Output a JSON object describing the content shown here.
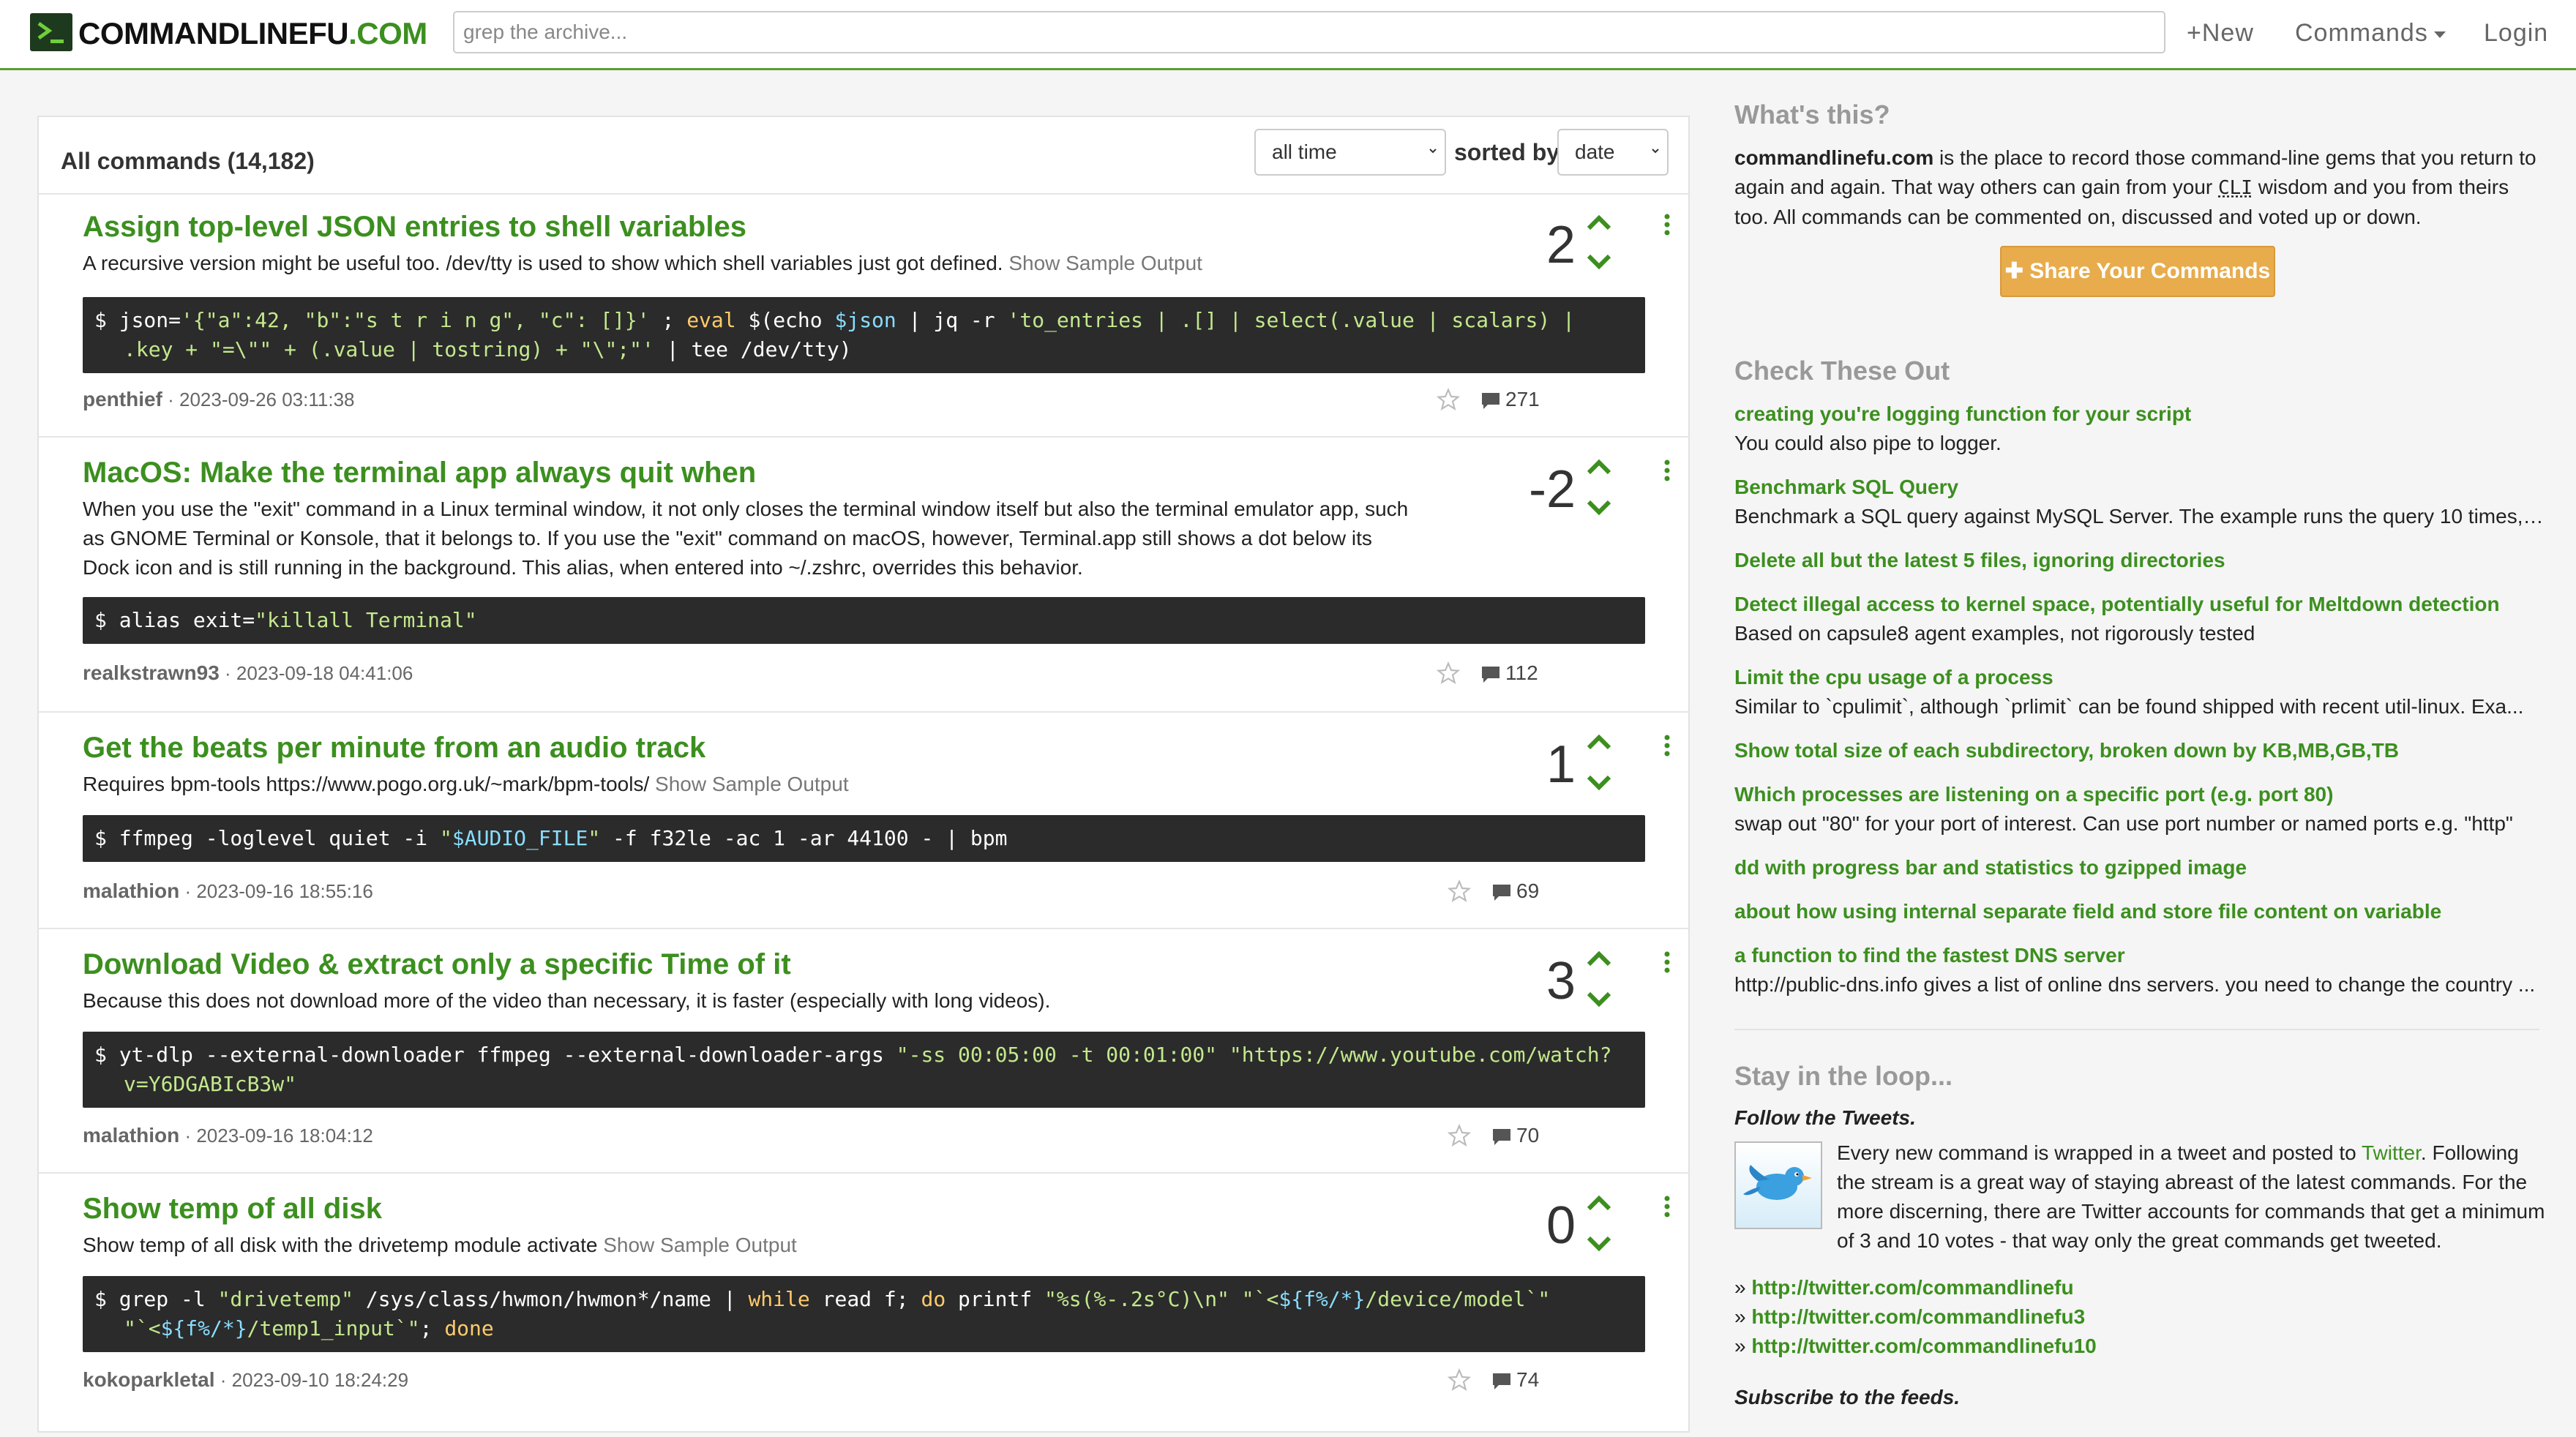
{
  "header": {
    "logo_main": "COMMANDLINEFU",
    "logo_tld": ".COM",
    "search_placeholder": "grep the archive...",
    "new_label": "+New",
    "commands_label": "Commands",
    "login_label": "Login",
    "brand_color": "#3c8f1f"
  },
  "main": {
    "title": "All commands (14,182)",
    "time_filter": "all time",
    "sorted_by_label": "sorted by",
    "sort_value": "date",
    "entries": [
      {
        "title": "Assign top-level JSON entries to shell variables",
        "description": "A recursive version might be useful too. /dev/tty is used to show which shell variables just got defined.",
        "sample_label": "Show Sample Output",
        "votes": "2",
        "author": "penthief",
        "date": "· 2023-09-26 03:11:38",
        "comments": "271"
      },
      {
        "title": "MacOS: Make the terminal app always quit when",
        "description": "When you use the \"exit\" command in a Linux terminal window, it not only closes the terminal window itself but also the terminal emulator app, such as GNOME Terminal or Konsole, that it belongs to. If you use the \"exit\" command on macOS, however, Terminal.app still shows a dot below its Dock icon and is still running in the background. This alias, when entered into ~/.zshrc, overrides this behavior.",
        "votes": "-2",
        "author": "realkstrawn93",
        "date": "· 2023-09-18 04:41:06",
        "comments": "112"
      },
      {
        "title": "Get the beats per minute from an audio track",
        "description": "Requires bpm-tools https://www.pogo.org.uk/~mark/bpm-tools/",
        "sample_label": "Show Sample Output",
        "votes": "1",
        "author": "malathion",
        "date": "· 2023-09-16 18:55:16",
        "comments": "69"
      },
      {
        "title": "Download Video & extract only a specific Time of it",
        "description": "Because this does not download more of the video than necessary, it is faster (especially with long videos).",
        "votes": "3",
        "author": "malathion",
        "date": "· 2023-09-16 18:04:12",
        "comments": "70"
      },
      {
        "title": "Show temp of all disk",
        "description": "Show temp of all disk with the drivetemp module activate",
        "sample_label": "Show Sample Output",
        "votes": "0",
        "author": "kokoparkletal",
        "date": "· 2023-09-10 18:24:29",
        "comments": "74"
      }
    ]
  },
  "sidebar": {
    "whats_this_heading": "What's this?",
    "whats_this_site": "commandlinefu.com",
    "whats_this_text_1": " is the place to record those command-line gems that you return to again and again. That way others can gain from your ",
    "whats_this_cli": "CLI",
    "whats_this_text_2": " wisdom and you from theirs too. All commands can be commented on, discussed and voted up or down.",
    "share_label": "Share Your Commands",
    "check_heading": "Check These Out",
    "check_items": [
      {
        "title": "creating you're logging function for your script",
        "desc": "You could also pipe to logger."
      },
      {
        "title": "Benchmark SQL Query",
        "desc": "Benchmark a SQL query against MySQL Server. The example runs the query 10 times, a..."
      },
      {
        "title": "Delete all but the latest 5 files, ignoring directories",
        "desc": ""
      },
      {
        "title": "Detect illegal access to kernel space, potentially useful for Meltdown detection",
        "desc": "Based on capsule8 agent examples, not rigorously tested"
      },
      {
        "title": "Limit the cpu usage of a process",
        "desc": "Similar to `cpulimit`, although `prlimit` can be found shipped with recent util-linux. Exa..."
      },
      {
        "title": "Show total size of each subdirectory, broken down by KB,MB,GB,TB",
        "desc": ""
      },
      {
        "title": "Which processes are listening on a specific port (e.g. port 80)",
        "desc": "swap out \"80\" for your port of interest. Can use port number or named ports e.g. \"http\""
      },
      {
        "title": "dd with progress bar and statistics to gzipped image",
        "desc": ""
      },
      {
        "title": "about how using internal separate field and store file content on variable",
        "desc": ""
      },
      {
        "title": "a function to find the fastest DNS server",
        "desc": "http://public-dns.info gives a list of online dns servers. you need to change the country ..."
      }
    ],
    "loop_heading": "Stay in the loop...",
    "follow_label": "Follow the Tweets.",
    "tweets_text_1": "Every new command is wrapped in a tweet and posted to ",
    "tweets_link": "Twitter",
    "tweets_text_2": ". Following the stream is a great way of staying abreast of the latest commands. For the more discerning, there are Twitter accounts for commands that get a minimum of 3 and 10 votes - that way only the great commands get tweeted.",
    "bullet": "»",
    "twitter_links": [
      "http://twitter.com/commandlinefu",
      "http://twitter.com/commandlinefu3",
      "http://twitter.com/commandlinefu10"
    ],
    "subscribe_label": "Subscribe to the feeds."
  }
}
